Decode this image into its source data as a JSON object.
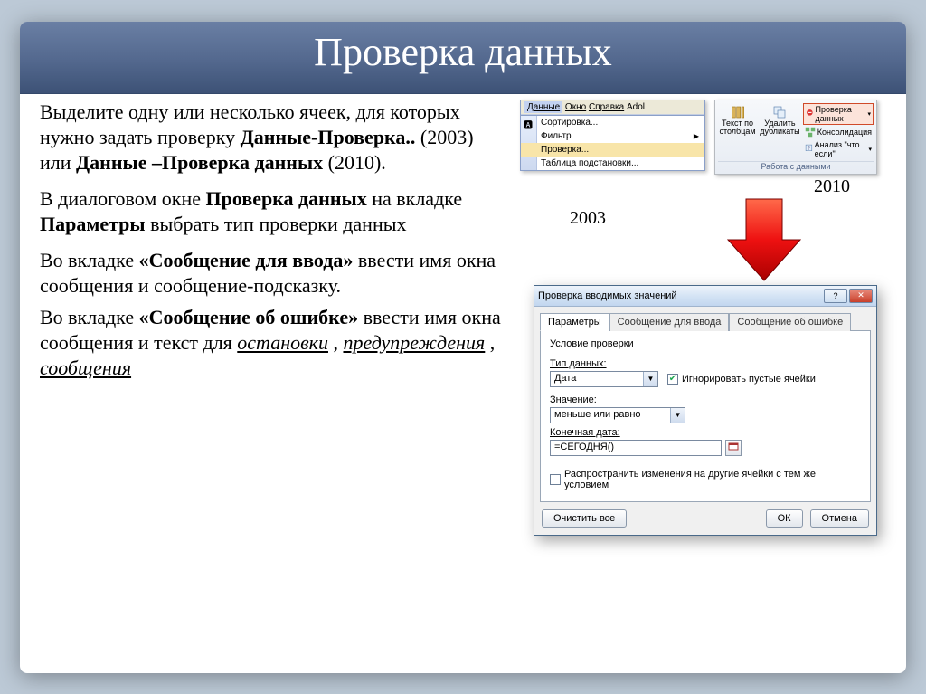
{
  "title": "Проверка данных",
  "para1": {
    "a": "Выделите одну или несколько ячеек, для которых нужно задать проверку ",
    "b": "Данные-Проверка..",
    "c": " (2003) или ",
    "d": "Данные –Проверка данных",
    "e": " (2010)."
  },
  "para2": {
    "a": "В диалоговом окне ",
    "b": "Проверка данных",
    "c": " на вкладке ",
    "d": "Параметры",
    "e": " выбрать тип проверки данных"
  },
  "para3": {
    "a": "Во вкладке ",
    "b": "«Сообщение для ввода»",
    "c": " ввести имя окна сообщения и сообщение-подсказку."
  },
  "para4": {
    "a": "Во вкладке ",
    "b": "«Сообщение об ошибке»",
    "c": " ввести имя окна сообщения и  текст для ",
    "d": "остановки",
    "e": ", ",
    "f": "предупреждения",
    "g": ", ",
    "h": "сообщения"
  },
  "menu2003": {
    "menubar": {
      "data": "Данные",
      "window": "Окно",
      "help": "Справка",
      "extra": "Adol"
    },
    "items": {
      "sort": "Сортировка...",
      "filter": "Фильтр",
      "check": "Проверка...",
      "table": "Таблица подстановки..."
    }
  },
  "caption2003": "2003",
  "caption2010": "2010",
  "ribbon": {
    "text_cols": "Текст по столбцам",
    "remove_dup": "Удалить дубликаты",
    "validation": "Проверка данных",
    "consolidation": "Консолидация",
    "whatif": "Анализ \"что если\"",
    "group": "Работа с данными"
  },
  "dialog": {
    "title": "Проверка вводимых значений",
    "tabs": {
      "params": "Параметры",
      "input": "Сообщение для ввода",
      "error": "Сообщение об ошибке"
    },
    "group_title": "Условие проверки",
    "fields": {
      "type_label": "Тип данных:",
      "type_value": "Дата",
      "ignore_blank": "Игнорировать пустые ячейки",
      "value_label": "Значение:",
      "value_value": "меньше или равно",
      "end_label": "Конечная дата:",
      "end_value": "=СЕГОДНЯ()",
      "propagate": "Распространить изменения на другие ячейки с тем же условием"
    },
    "buttons": {
      "clear": "Очистить все",
      "ok": "ОК",
      "cancel": "Отмена"
    }
  }
}
